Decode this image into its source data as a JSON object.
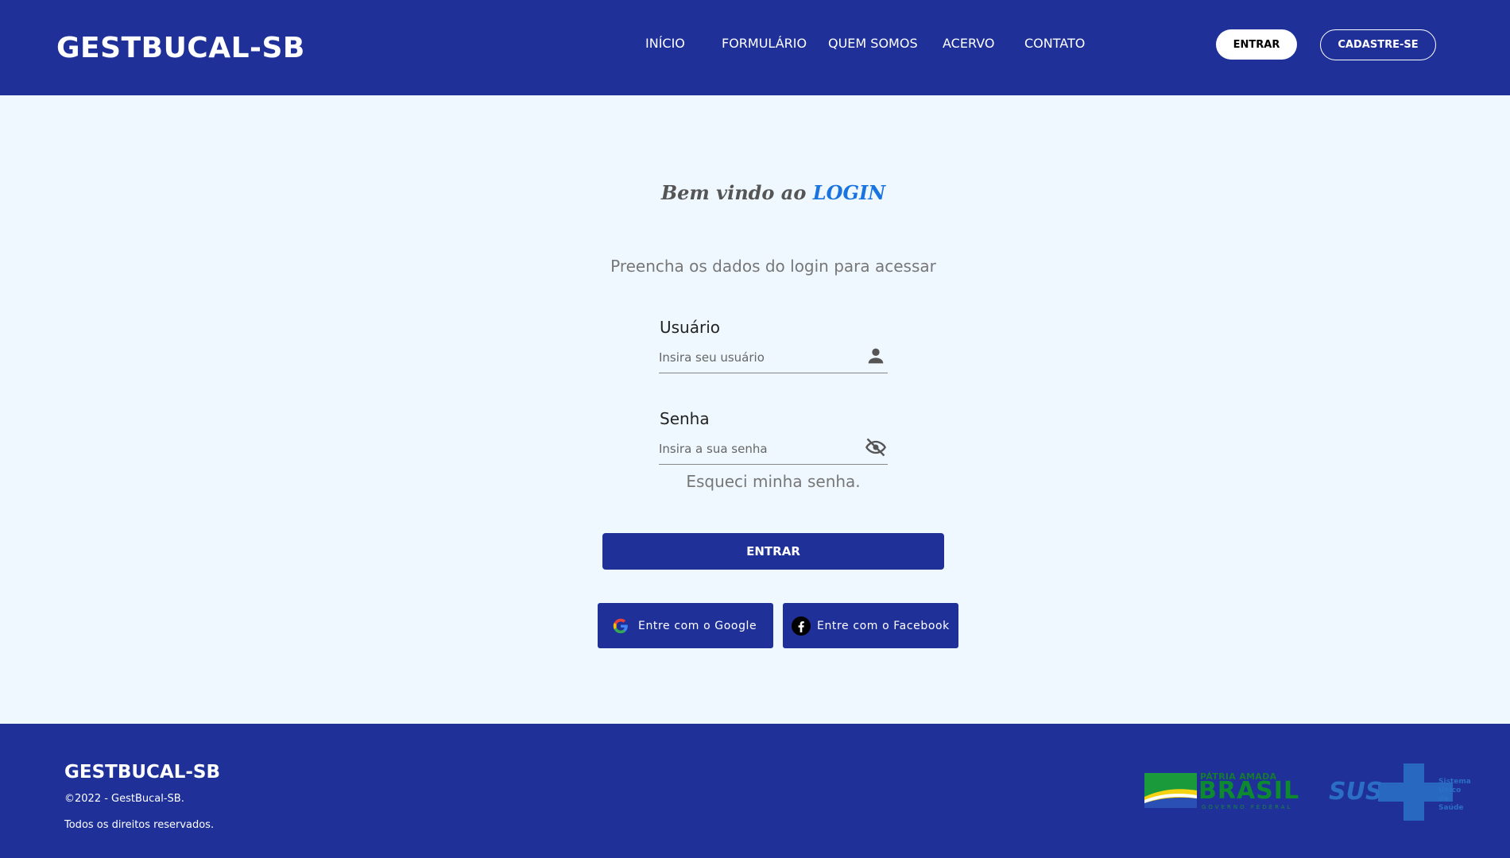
{
  "header": {
    "logo": "GESTBUCAL-SB",
    "nav": [
      "INÍCIO",
      "FORMULÁRIO",
      "QUEM SOMOS",
      "ACERVO",
      "CONTATO"
    ],
    "login_button": "ENTRAR",
    "signup_button": "CADASTRE-SE"
  },
  "main": {
    "welcome_prefix": "Bem vindo ao",
    "welcome_accent": "LOGIN",
    "subtitle": "Preencha os dados do login para acessar",
    "username": {
      "label": "Usuário",
      "placeholder": "Insira seu usuário",
      "value": "",
      "icon": "user-icon"
    },
    "password": {
      "label": "Senha",
      "placeholder": "Insira a sua senha",
      "value": "",
      "icon": "eye-off-icon"
    },
    "forgot_link": "Esqueci minha senha.",
    "submit_button": "ENTRAR",
    "google_button": "Entre com o Google",
    "facebook_button": "Entre com o Facebook"
  },
  "footer": {
    "logo": "GESTBUCAL-SB",
    "copyright": "©2022 - GestBucal-SB.",
    "rights": "Todos os direitos reservados.",
    "brasil_logo": {
      "top": "PÁTRIA AMADA",
      "main": "BRASIL",
      "sub": "GOVERNO FEDERAL"
    },
    "sus_logo": {
      "main": "SUS",
      "side": [
        "Sistema",
        "Único",
        "de Saúde"
      ]
    }
  },
  "colors": {
    "primary": "#1f3199",
    "background": "#f0f8ff",
    "accent": "#1a74e0",
    "white": "#ffffff"
  }
}
